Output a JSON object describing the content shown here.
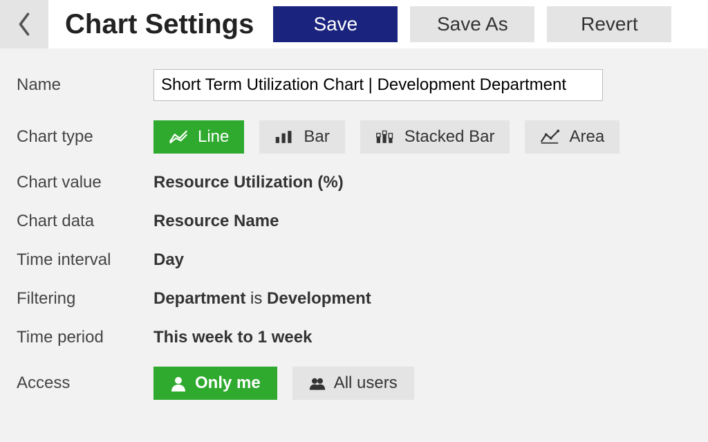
{
  "header": {
    "title": "Chart Settings",
    "save": "Save",
    "save_as": "Save As",
    "revert": "Revert"
  },
  "labels": {
    "name": "Name",
    "chart_type": "Chart type",
    "chart_value": "Chart value",
    "chart_data": "Chart data",
    "time_interval": "Time interval",
    "filtering": "Filtering",
    "time_period": "Time period",
    "access": "Access"
  },
  "fields": {
    "name_value": "Short Term Utilization Chart | Development Department",
    "chart_value": "Resource Utilization (%)",
    "chart_data": "Resource Name",
    "time_interval": "Day",
    "filter_field": "Department",
    "filter_op": " is ",
    "filter_value": "Development",
    "time_period": "This week to 1 week"
  },
  "chart_types": {
    "line": "Line",
    "bar": "Bar",
    "stacked_bar": "Stacked Bar",
    "area": "Area",
    "selected": "line"
  },
  "access": {
    "only_me": "Only me",
    "all_users": "All users",
    "selected": "only_me"
  },
  "colors": {
    "primary_button": "#1a237e",
    "selected_green": "#2faa2f",
    "gray_button": "#e4e4e4"
  }
}
